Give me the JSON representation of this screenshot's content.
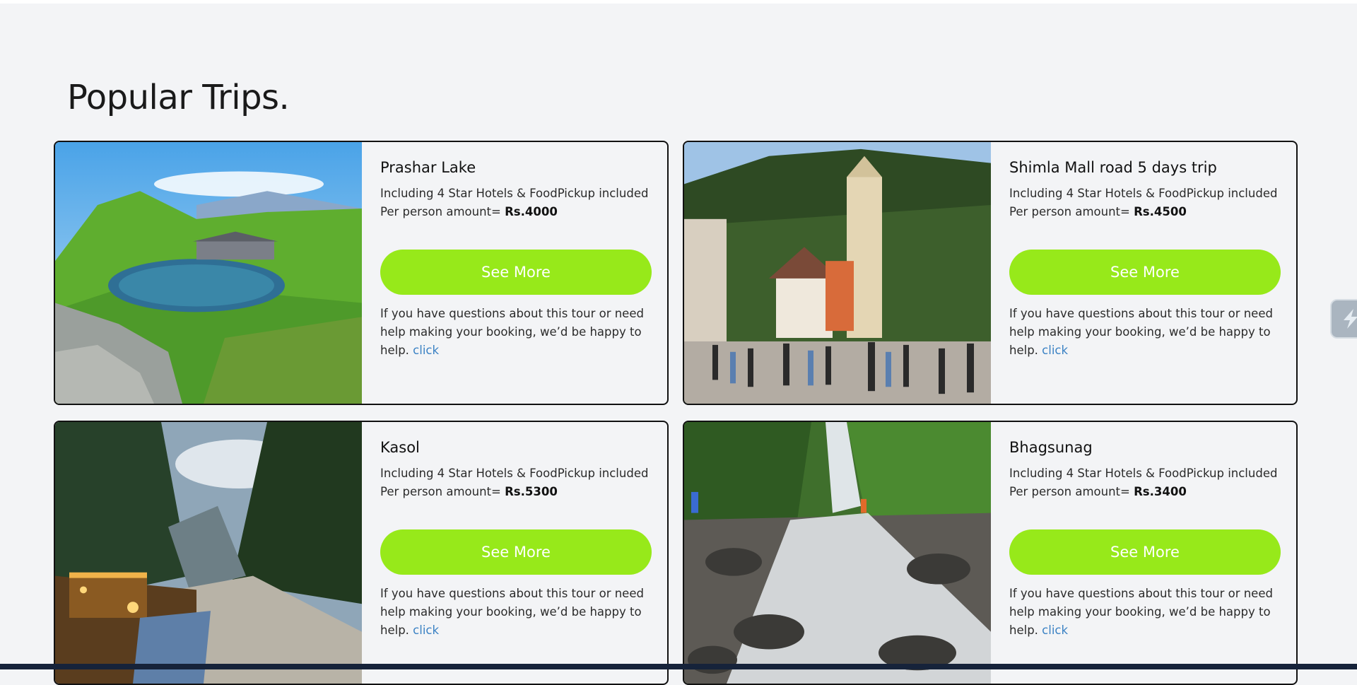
{
  "section": {
    "title": "Popular Trips."
  },
  "trips": [
    {
      "title": "Prashar Lake",
      "description": "Including 4 Star Hotels & FoodPickup included",
      "price_label": "Per person amount=",
      "price": "Rs.4000",
      "button_label": "See More",
      "help_text": "If you have questions about this tour or need help making your booking, we’d be happy to help.",
      "help_link": "click"
    },
    {
      "title": "Shimla Mall road 5 days trip",
      "description": "Including 4 Star Hotels & FoodPickup included",
      "price_label": "Per person amount=",
      "price": "Rs.4500",
      "button_label": "See More",
      "help_text": "If you have questions about this tour or need help making your booking, we’d be happy to help.",
      "help_link": "click"
    },
    {
      "title": "Kasol",
      "description": "Including 4 Star Hotels & FoodPickup included",
      "price_label": "Per person amount=",
      "price": "Rs.5300",
      "button_label": "See More",
      "help_text": "If you have questions about this tour or need help making your booking, we’d be happy to help.",
      "help_link": "click"
    },
    {
      "title": "Bhagsunag",
      "description": "Including 4 Star Hotels & FoodPickup included",
      "price_label": "Per person amount=",
      "price": "Rs.3400",
      "button_label": "See More",
      "help_text": "If you have questions about this tour or need help making your booking, we’d be happy to help.",
      "help_link": "click"
    }
  ],
  "colors": {
    "accent": "#97e91a",
    "link": "#3b82c4",
    "background": "#f3f4f6"
  },
  "icons": {
    "floating_widget": "lightning-bolt-icon"
  }
}
